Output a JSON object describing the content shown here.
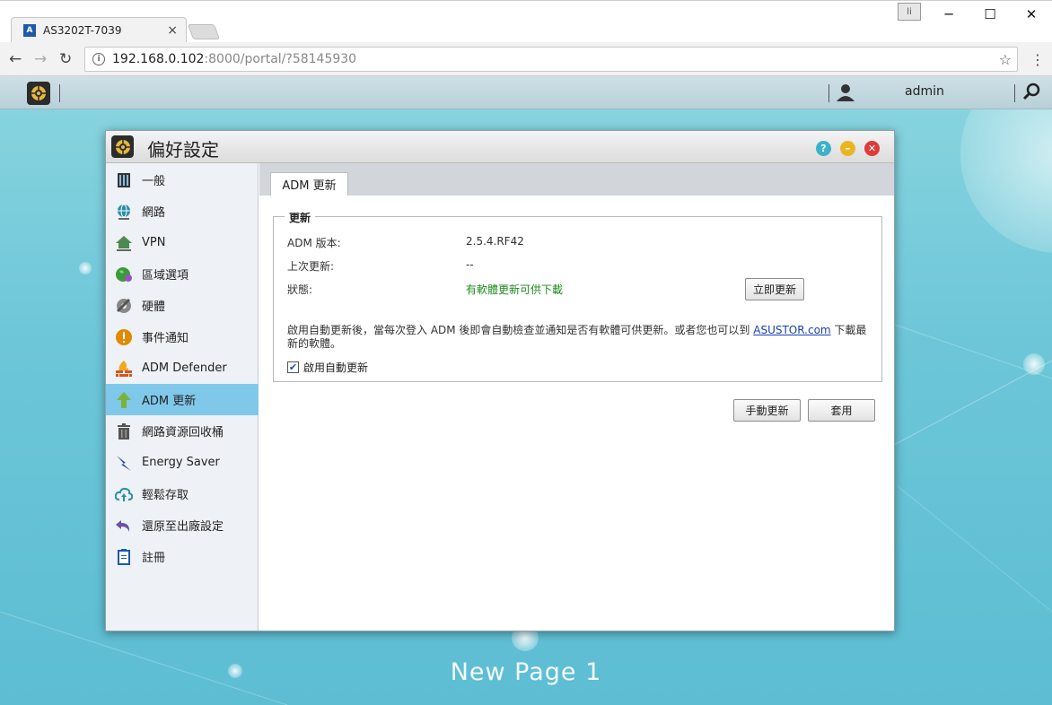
{
  "browser": {
    "tab_title": "AS3202T-7039",
    "tab_close": "×",
    "favicon_text": "A",
    "url_host": "192.168.0.102",
    "url_path": ":8000/portal/?58145930",
    "window_minimize": "─",
    "window_maximize": "☐",
    "window_close": "✕"
  },
  "adm_bar": {
    "user": "admin"
  },
  "window": {
    "title": "偏好設定",
    "help_glyph": "?",
    "minimize_glyph": "–",
    "close_glyph": "✕"
  },
  "sidebar": {
    "items": [
      {
        "label": "一般",
        "icon": "server-icon",
        "color": "#444444"
      },
      {
        "label": "網路",
        "icon": "globe-network-icon",
        "color": "#2a8fa8"
      },
      {
        "label": "VPN",
        "icon": "house-vpn-icon",
        "color": "#4c8a52"
      },
      {
        "label": "區域選項",
        "icon": "region-globe-icon",
        "color": "#3a9a3a"
      },
      {
        "label": "硬體",
        "icon": "hardware-icon",
        "color": "#777777"
      },
      {
        "label": "事件通知",
        "icon": "alert-icon",
        "color": "#e08a00"
      },
      {
        "label": "ADM Defender",
        "icon": "firewall-icon",
        "color": "#d9541e"
      },
      {
        "label": "ADM 更新",
        "icon": "update-arrow-icon",
        "color": "#7ab33a"
      },
      {
        "label": "網路資源回收桶",
        "icon": "trash-icon",
        "color": "#555555"
      },
      {
        "label": "Energy Saver",
        "icon": "energy-icon",
        "color": "#2948a8"
      },
      {
        "label": "輕鬆存取",
        "icon": "cloud-upload-icon",
        "color": "#2a8fa8"
      },
      {
        "label": "還原至出廠設定",
        "icon": "restore-icon",
        "color": "#6b4fa8"
      },
      {
        "label": "註冊",
        "icon": "register-icon",
        "color": "#1e5aa8"
      }
    ],
    "active_index": 7
  },
  "content": {
    "tab_label": "ADM 更新",
    "legend": "更新",
    "rows": [
      {
        "label": "ADM 版本:",
        "value": "2.5.4.RF42"
      },
      {
        "label": "上次更新:",
        "value": "--"
      },
      {
        "label": "狀態:",
        "value": "有軟體更新可供下載"
      }
    ],
    "update_now_label": "立即更新",
    "note_text": "啟用自動更新後，當每次登入 ADM 後即會自動檢查並通知是否有軟體可供更新。或者您也可以到 ",
    "note_link": "ASUSTOR.com",
    "note_tail": " 下載最新的軟體。",
    "auto_update_label": "啟用自動更新",
    "auto_update_checked": true,
    "manual_update_label": "手動更新",
    "apply_label": "套用"
  },
  "desktop": {
    "page_label": "New Page 1"
  }
}
